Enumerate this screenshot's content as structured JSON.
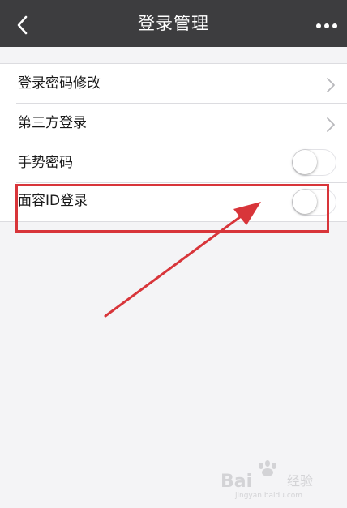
{
  "navbar": {
    "title": "登录管理",
    "back_icon": "chevron-left-icon",
    "more_icon": "more-dots-icon"
  },
  "settings": {
    "items": [
      {
        "label": "登录密码修改",
        "control": "chevron"
      },
      {
        "label": "第三方登录",
        "control": "chevron"
      },
      {
        "label": "手势密码",
        "control": "toggle",
        "on": false
      },
      {
        "label": "面容ID登录",
        "control": "toggle",
        "on": false
      }
    ]
  },
  "colors": {
    "navbar_bg": "#3d3d3f",
    "page_bg": "#f4f4f6",
    "annotation_red": "#d8353a"
  },
  "watermark": {
    "brand": "Bai",
    "suffix": "经验",
    "url": "jingyan.baidu.com"
  }
}
